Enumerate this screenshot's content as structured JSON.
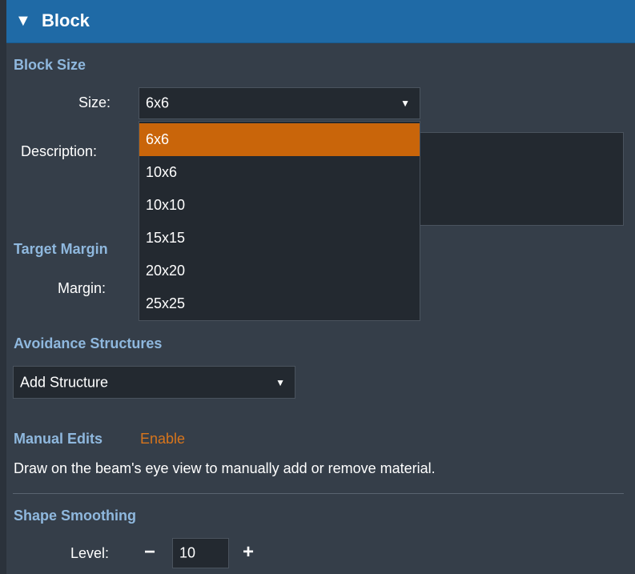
{
  "header": {
    "toggle_icon": "triangle-down-icon",
    "title": "Block"
  },
  "block_size": {
    "section_label": "Block Size",
    "size_label": "Size:",
    "size_value": "6x6",
    "description_label": "Description:",
    "options": [
      "6x6",
      "10x6",
      "10x10",
      "15x15",
      "20x20",
      "25x25"
    ],
    "selected_option": "6x6"
  },
  "target_margin": {
    "section_label": "Target Margin",
    "margin_label": "Margin:"
  },
  "avoidance": {
    "section_label": "Avoidance Structures",
    "add_structure": "Add Structure"
  },
  "manual_edits": {
    "section_label": "Manual Edits",
    "enable_link": "Enable",
    "description": "Draw on the beam's eye view to manually add or remove material."
  },
  "shape_smoothing": {
    "section_label": "Shape Smoothing",
    "level_label": "Level:",
    "level_value": "10",
    "minus": "−",
    "plus": "+"
  },
  "colors": {
    "header": "#1f6aa6",
    "panel": "#353e49",
    "section_label": "#8fb8de",
    "accent_orange": "#c9650a",
    "link_orange": "#d8751c"
  }
}
